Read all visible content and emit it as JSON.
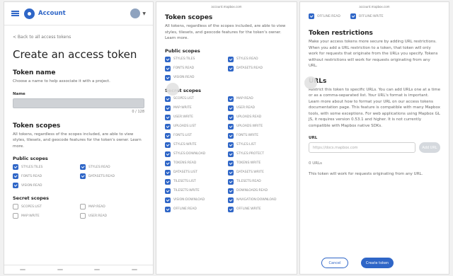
{
  "header": {
    "brand": "Account"
  },
  "page": {
    "back_link": "< Back to all access tokens",
    "title": "Create an access token",
    "token_name": {
      "heading": "Token name",
      "description": "Choose a name to help associate it with a project.",
      "field_label": "Name",
      "counter": "0 / 128"
    }
  },
  "scopes": {
    "heading": "Token scopes",
    "description": "All tokens, regardless of the scopes included, are able to view styles, tilesets, and geocode features for the token's owner. Learn more.",
    "public_heading": "Public scopes",
    "public": [
      {
        "label": "STYLES:TILES",
        "checked": true
      },
      {
        "label": "STYLES:READ",
        "checked": true
      },
      {
        "label": "FONTS:READ",
        "checked": true
      },
      {
        "label": "DATASETS:READ",
        "checked": true
      },
      {
        "label": "VISION:READ",
        "checked": true
      }
    ],
    "secret_heading": "Secret scopes",
    "secret": [
      {
        "label": "SCOPES:LIST",
        "checked": true
      },
      {
        "label": "MAP:READ",
        "checked": true
      },
      {
        "label": "MAP:WRITE",
        "checked": true
      },
      {
        "label": "USER:READ",
        "checked": true
      },
      {
        "label": "USER:WRITE",
        "checked": true
      },
      {
        "label": "UPLOADS:READ",
        "checked": true
      },
      {
        "label": "UPLOADS:LIST",
        "checked": true
      },
      {
        "label": "UPLOADS:WRITE",
        "checked": true
      },
      {
        "label": "FONTS:LIST",
        "checked": true
      },
      {
        "label": "FONTS:WRITE",
        "checked": true
      },
      {
        "label": "STYLES:WRITE",
        "checked": true
      },
      {
        "label": "STYLES:LIST",
        "checked": true
      },
      {
        "label": "STYLES:DOWNLOAD",
        "checked": true
      },
      {
        "label": "STYLES:PROTECT",
        "checked": true
      },
      {
        "label": "TOKENS:READ",
        "checked": true
      },
      {
        "label": "TOKENS:WRITE",
        "checked": true
      },
      {
        "label": "DATASETS:LIST",
        "checked": true
      },
      {
        "label": "DATASETS:WRITE",
        "checked": true
      },
      {
        "label": "TILESETS:LIST",
        "checked": true
      },
      {
        "label": "TILESETS:READ",
        "checked": true
      },
      {
        "label": "TILESETS:WRITE",
        "checked": true
      },
      {
        "label": "DOWNLOADS:READ",
        "checked": true
      },
      {
        "label": "VISION:DOWNLOAD",
        "checked": true
      },
      {
        "label": "NAVIGATION:DOWNLOAD",
        "checked": true
      },
      {
        "label": "OFFLINE:READ",
        "checked": true
      },
      {
        "label": "OFFLINE:WRITE",
        "checked": true
      }
    ],
    "secret_preview": [
      {
        "label": "SCOPES:LIST",
        "checked": false
      },
      {
        "label": "MAP:READ",
        "checked": false
      },
      {
        "label": "MAP:WRITE",
        "checked": false
      },
      {
        "label": "USER:READ",
        "checked": false
      }
    ]
  },
  "mid_header": {
    "line1": "",
    "line2": "account.mapbox.com"
  },
  "right_header": {
    "line1": "",
    "line2": "account.mapbox.com"
  },
  "right_top": [
    {
      "label": "OFFLINE:READ",
      "checked": true
    },
    {
      "label": "OFFLINE:WRITE",
      "checked": true
    }
  ],
  "restrictions": {
    "heading": "Token restrictions",
    "description": "Make your access tokens more secure by adding URL restrictions. When you add a URL restriction to a token, that token will only work for requests that originate from the URLs you specify. Tokens without restrictions will work for requests originating from any URL.",
    "urls_heading": "URLs",
    "urls_description": "Restrict this token to specific URLs. You can add URLs one at a time or as a comma-separated list. Your URL's format is important. Learn more about how to format your URL on our access tokens documentation page. This feature is compatible with many Mapbox tools, with some exceptions. For web applications using Mapbox GL JS, it requires version 0.53.1 and higher. It is not currently compatible with Mapbox native SDKs.",
    "url_label": "URL",
    "url_placeholder": "https://docs.mapbox.com",
    "add_label": "Add URL",
    "count": "0 URLs",
    "note": "This token will work for requests originating from any URL.",
    "cancel": "Cancel",
    "create": "Create token"
  }
}
